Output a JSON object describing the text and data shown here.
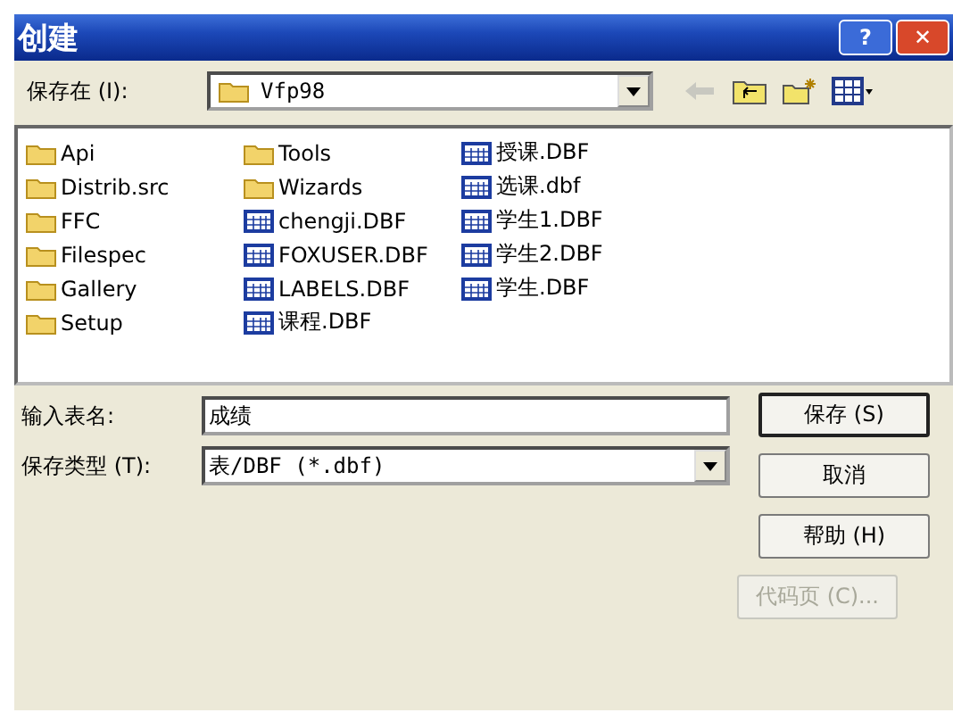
{
  "window": {
    "title": "创建",
    "buttons": [
      {
        "kind": "help",
        "label": "?"
      },
      {
        "kind": "close",
        "label": "✕"
      }
    ]
  },
  "save_in": {
    "label": "保存在 (I):",
    "value": "Vfp98"
  },
  "files": [
    {
      "name": "Api",
      "kind": "folder"
    },
    {
      "name": "Distrib.src",
      "kind": "folder"
    },
    {
      "name": "FFC",
      "kind": "folder"
    },
    {
      "name": "Filespec",
      "kind": "folder"
    },
    {
      "name": "Gallery",
      "kind": "folder"
    },
    {
      "name": "Setup",
      "kind": "folder"
    },
    {
      "name": "Tools",
      "kind": "folder"
    },
    {
      "name": "Wizards",
      "kind": "folder"
    },
    {
      "name": "chengji.DBF",
      "kind": "table"
    },
    {
      "name": "FOXUSER.DBF",
      "kind": "table"
    },
    {
      "name": "LABELS.DBF",
      "kind": "table"
    },
    {
      "name": "课程.DBF",
      "kind": "table"
    },
    {
      "name": "授课.DBF",
      "kind": "table"
    },
    {
      "name": "选课.dbf",
      "kind": "table"
    },
    {
      "name": "学生1.DBF",
      "kind": "table"
    },
    {
      "name": "学生2.DBF",
      "kind": "table"
    },
    {
      "name": "学生.DBF",
      "kind": "table"
    }
  ],
  "file_name": {
    "label": "输入表名:",
    "value": "成绩"
  },
  "file_type": {
    "label": "保存类型 (T):",
    "value": "表/DBF (*.dbf)"
  },
  "buttons": [
    {
      "label": "保存 (S)",
      "default": true,
      "disabled": false
    },
    {
      "label": "取消",
      "default": false,
      "disabled": false
    },
    {
      "label": "帮助 (H)",
      "default": false,
      "disabled": false
    },
    {
      "label": "代码页 (C)...",
      "default": false,
      "disabled": true
    }
  ]
}
